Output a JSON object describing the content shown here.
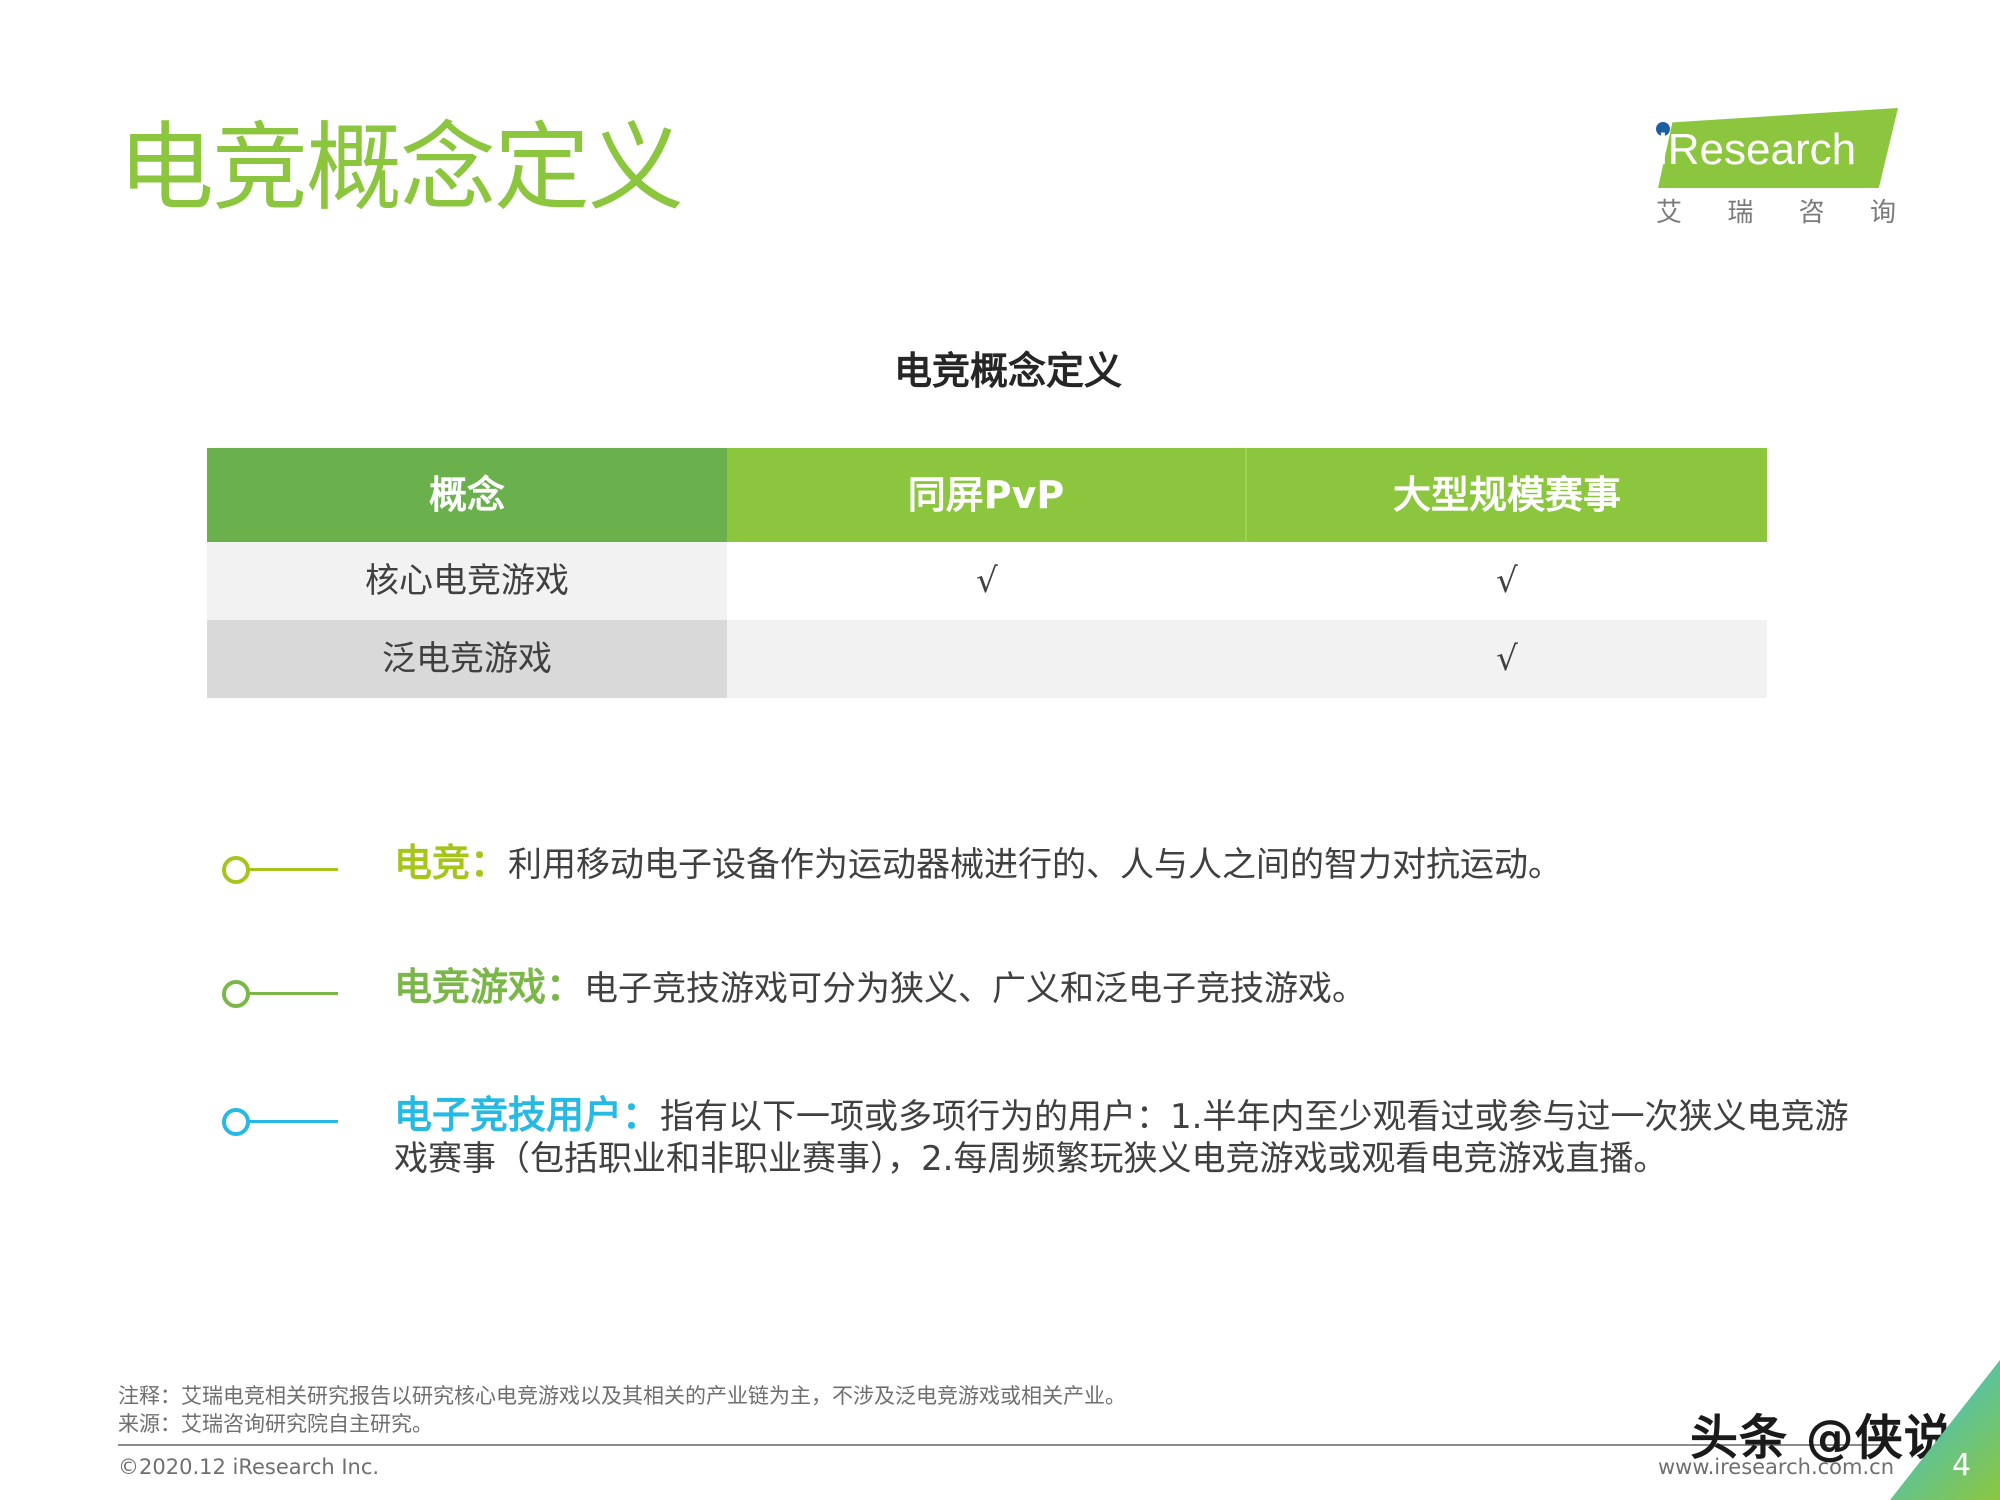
{
  "header": {
    "title": "电竞概念定义",
    "logo": {
      "word": "iResearch",
      "cn_chars": [
        "艾",
        "瑞",
        "咨",
        "询"
      ]
    }
  },
  "section_title": "电竞概念定义",
  "table": {
    "headers": [
      "概念",
      "同屏PvP",
      "大型规模赛事"
    ],
    "rows": [
      [
        "核心电竞游戏",
        "√",
        "√"
      ],
      [
        "泛电竞游戏",
        "",
        "√"
      ]
    ]
  },
  "definitions": [
    {
      "term": "电竞：",
      "text": "利用移动电子设备作为运动器械进行的、人与人之间的智力对抗运动。",
      "color": "#a6c51a"
    },
    {
      "term": "电竞游戏：",
      "text": "电子竞技游戏可分为狭义、广义和泛电子竞技游戏。",
      "color": "#7ab648"
    },
    {
      "term": "电子竞技用户：",
      "text": "指有以下一项或多项行为的用户：1.半年内至少观看过或参与过一次狭义电竞游戏赛事（包括职业和非职业赛事），2.每周频繁玩狭义电竞游戏或观看电竞游戏直播。",
      "color": "#26b9e3"
    }
  ],
  "footnotes": {
    "note": "注释：艾瑞电竞相关研究报告以研究核心电竞游戏以及其相关的产业链为主，不涉及泛电竞游戏或相关产业。",
    "source": "来源：艾瑞咨询研究院自主研究。"
  },
  "footer": {
    "copyright": "©2020.12 iResearch Inc.",
    "url": "www.iresearch.com.cn",
    "page_number": "4",
    "watermark": "头条 @侠说"
  },
  "colors": {
    "title_green": "#8cc63f",
    "header_dark_green": "#6ab04c",
    "header_green": "#8cc63f"
  }
}
